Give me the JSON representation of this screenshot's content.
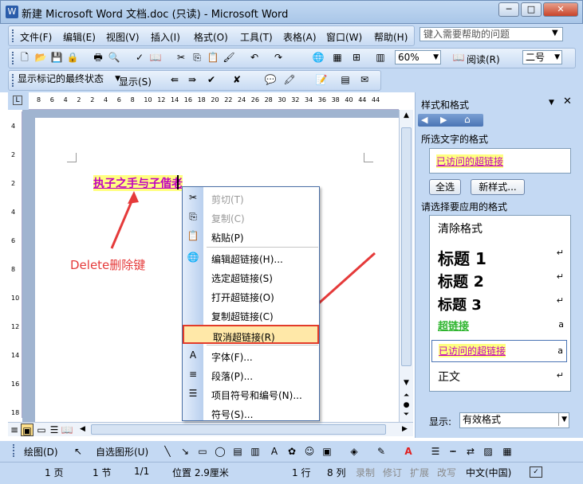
{
  "window": {
    "title": "新建 Microsoft Word 文档.doc (只读) - Microsoft Word",
    "app_icon": "W",
    "min": "─",
    "max": "□",
    "close": "✕"
  },
  "menu": [
    "文件(F)",
    "编辑(E)",
    "视图(V)",
    "插入(I)",
    "格式(O)",
    "工具(T)",
    "表格(A)",
    "窗口(W)",
    "帮助(H)"
  ],
  "help_placeholder": "键入需要帮助的问题",
  "toolbar": {
    "zoom": "60%",
    "read_label": "阅读(R)",
    "font_size": "二号"
  },
  "review_toolbar": {
    "display_mode": "显示标记的最终状态",
    "show_label": "显示(S)"
  },
  "ruler_numbers": [
    "8",
    "6",
    "4",
    "2",
    "2",
    "4",
    "6",
    "8",
    "10",
    "12",
    "14",
    "16",
    "18",
    "20",
    "22",
    "24",
    "26",
    "28",
    "30",
    "32",
    "34",
    "36",
    "38",
    "40",
    "44",
    "44"
  ],
  "vruler_numbers": [
    "4",
    "2",
    "2",
    "4",
    "6",
    "8",
    "10",
    "12",
    "14",
    "16",
    "18"
  ],
  "document": {
    "link_text": "执子之手与子偕老",
    "annotation": "Delete删除键"
  },
  "context_menu": [
    {
      "label": "剪切(T)",
      "icon": "✂",
      "disabled": true
    },
    {
      "label": "复制(C)",
      "icon": "⎘",
      "disabled": true
    },
    {
      "label": "粘贴(P)",
      "icon": "📋",
      "disabled": false,
      "sep_after": true
    },
    {
      "label": "编辑超链接(H)...",
      "icon": "🌐",
      "disabled": false
    },
    {
      "label": "选定超链接(S)",
      "icon": "",
      "disabled": false
    },
    {
      "label": "打开超链接(O)",
      "icon": "",
      "disabled": false
    },
    {
      "label": "复制超链接(C)",
      "icon": "",
      "disabled": false
    },
    {
      "label": "取消超链接(R)",
      "icon": "",
      "disabled": false,
      "selected": true,
      "sep_after": true
    },
    {
      "label": "字体(F)...",
      "icon": "A",
      "disabled": false
    },
    {
      "label": "段落(P)...",
      "icon": "≡",
      "disabled": false
    },
    {
      "label": "项目符号和编号(N)...",
      "icon": "☰",
      "disabled": false
    },
    {
      "label": "符号(S)...",
      "icon": "",
      "disabled": false
    }
  ],
  "task_pane": {
    "title": "样式和格式",
    "selected_label": "所选文字的格式",
    "selected_style": "已访问的超链接",
    "select_all": "全选",
    "new_style": "新样式...",
    "apply_label": "请选择要应用的格式",
    "styles": [
      {
        "name": "清除格式",
        "mark": "",
        "size": 14,
        "bold": false,
        "color": "#000"
      },
      {
        "name": "标题 1",
        "mark": "↵",
        "size": 20,
        "bold": true,
        "color": "#000"
      },
      {
        "name": "标题 2",
        "mark": "↵",
        "size": 19,
        "bold": true,
        "color": "#000"
      },
      {
        "name": "标题 3",
        "mark": "↵",
        "size": 18,
        "bold": true,
        "color": "#000"
      },
      {
        "name": "超链接",
        "mark": "a",
        "size": 13,
        "bold": true,
        "color": "#2fb52f"
      },
      {
        "name": "已访问的超链接",
        "mark": "a",
        "size": 12,
        "bold": false,
        "color": "#c000c0"
      },
      {
        "name": "正文",
        "mark": "↵",
        "size": 14,
        "bold": false,
        "color": "#000"
      }
    ],
    "show_label": "显示:",
    "show_value": "有效格式"
  },
  "drawing_toolbar": {
    "draw_label": "绘图(D)",
    "autoshape_label": "自选图形(U)"
  },
  "status": {
    "page": "1 页",
    "section": "1 节",
    "pages": "1/1",
    "position": "位置 2.9厘米",
    "line": "1 行",
    "col": "8 列",
    "rec": "录制",
    "trk": "修订",
    "ext": "扩展",
    "ovr": "改写",
    "lang": "中文(中国)"
  },
  "colors": {
    "accent": "#c4d9f3",
    "link": "#c000c0",
    "highlight": "#ffff80",
    "annotation": "#e53a3a"
  }
}
